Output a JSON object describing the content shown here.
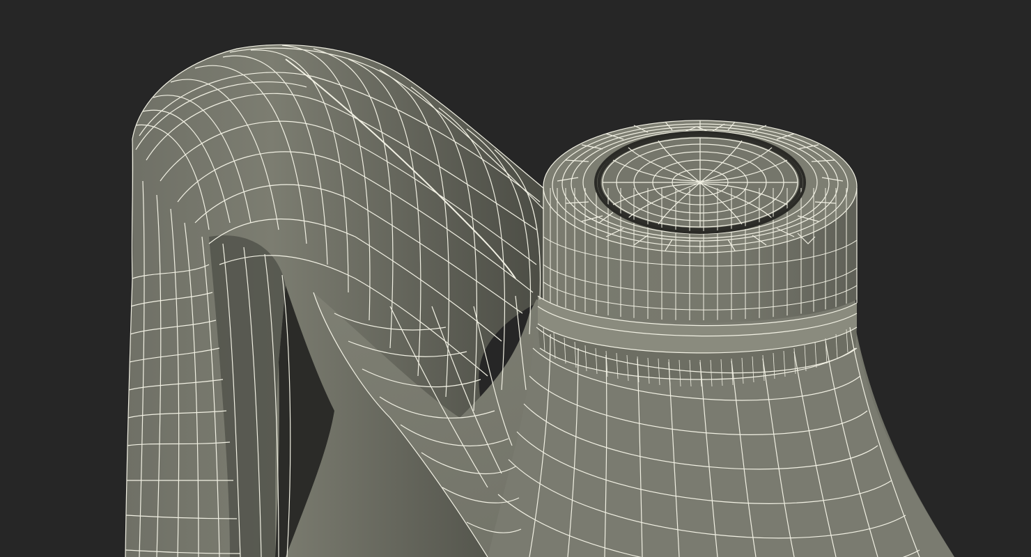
{
  "scene": {
    "subject": "wireframe-render-bottle-handle-and-cap",
    "colors": {
      "background": "#262626",
      "surface": "#7a7b6f",
      "surface_shadow": "#56574e",
      "surface_dark": "#3e3f39",
      "wire": "#f2f1e4"
    }
  }
}
